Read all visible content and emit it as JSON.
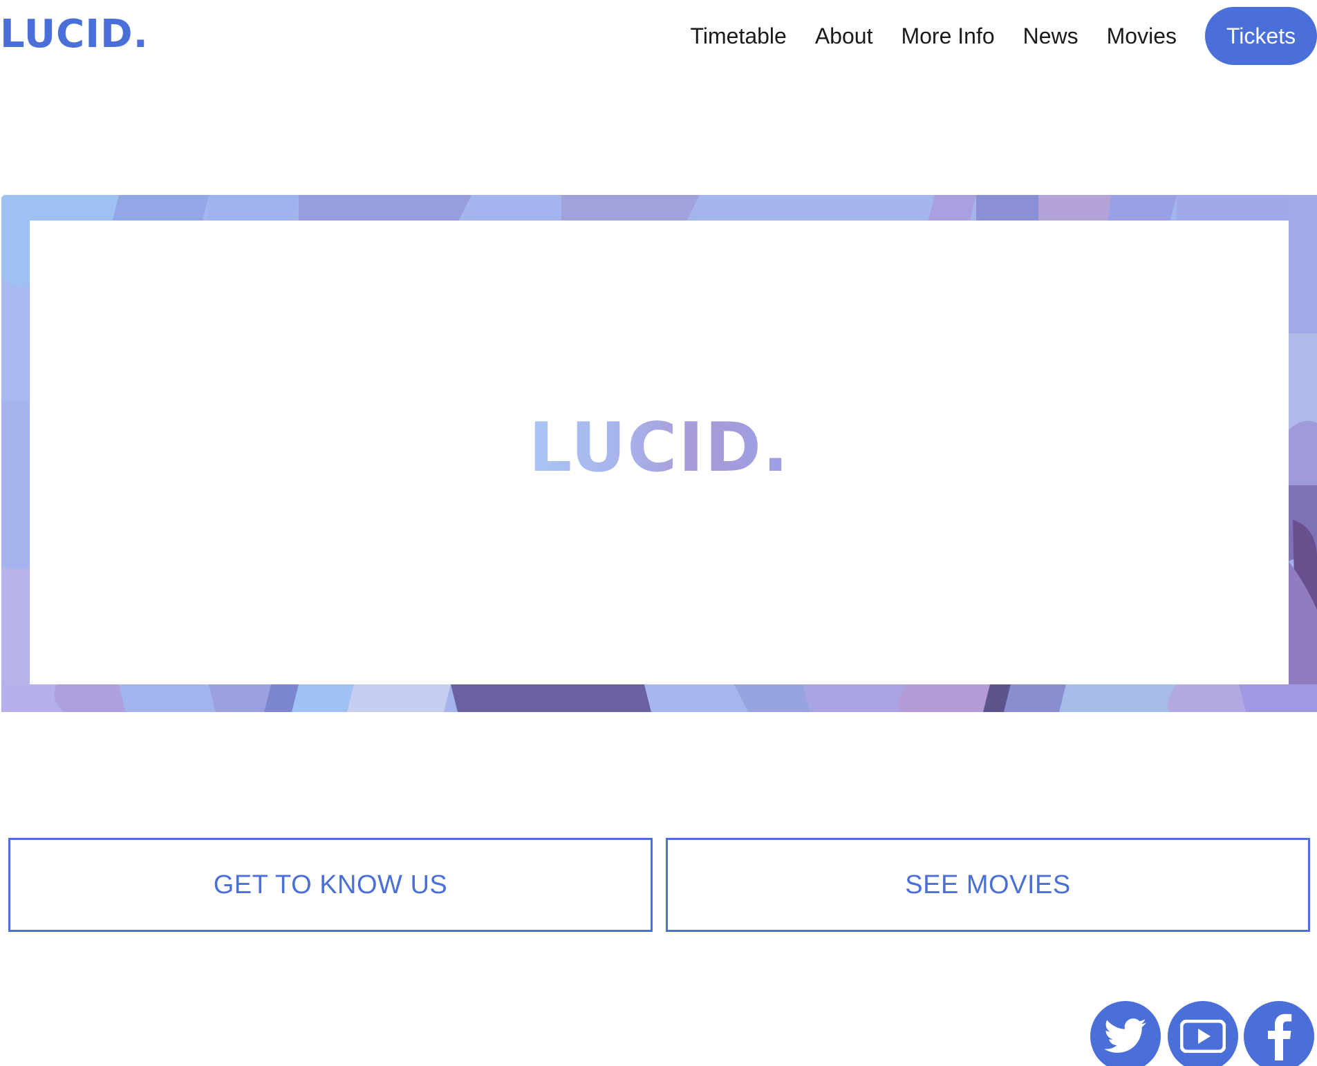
{
  "header": {
    "logo": "LUCID.",
    "nav": [
      {
        "label": "Timetable"
      },
      {
        "label": "About"
      },
      {
        "label": "More Info"
      },
      {
        "label": "News"
      },
      {
        "label": "Movies"
      }
    ],
    "tickets_label": "Tickets"
  },
  "hero": {
    "logo": "LUCID."
  },
  "cta": {
    "left_label": "GET TO KNOW US",
    "right_label": "SEE MOVIES"
  },
  "social": {
    "icons": [
      "twitter-icon",
      "youtube-icon",
      "facebook-icon"
    ]
  },
  "colors": {
    "accent": "#4a6fd8",
    "nav_text": "#1a1a1a",
    "background": "#ffffff",
    "hero_border_light": "#a4b5ee",
    "hero_border_dark": "#6a5c9e"
  }
}
